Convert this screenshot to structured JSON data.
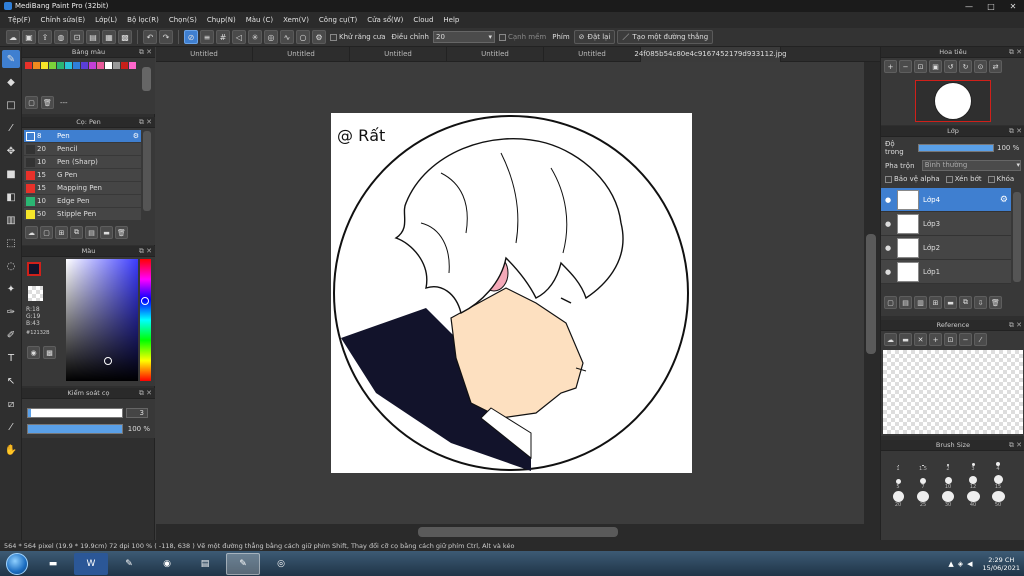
{
  "window": {
    "title": "MediBang Paint Pro (32bit)",
    "controls": [
      "—",
      "□",
      "✕"
    ]
  },
  "menu": [
    "Tệp(F)",
    "Chỉnh sửa(E)",
    "Lớp(L)",
    "Bộ lọc(R)",
    "Chọn(S)",
    "Chụp(N)",
    "Màu (C)",
    "Xem(V)",
    "Công cụ(T)",
    "Cửa sổ(W)",
    "Cloud",
    "Help"
  ],
  "toolbar": {
    "antialias_label": "Khử răng cưa",
    "correction_label": "Điều chỉnh",
    "correction_value": "20",
    "margin_label": "Cạnh mềm",
    "key_label": "Phím",
    "reset_label": "Đặt lại",
    "straight_line_label": "Tạo một đường thẳng"
  },
  "doc_tabs": [
    "Untitled",
    "Untitled",
    "Untitled",
    "Untitled",
    "Untitled",
    "24f085b54c80e4c9167452179d933112.jpg"
  ],
  "left": {
    "palette_title": "Bảng màu",
    "palette_colors": [
      "#e8312a",
      "#f08a1f",
      "#f5e52a",
      "#7cd33a",
      "#2bb673",
      "#2bc4d9",
      "#2f7fd9",
      "#5a3fd6",
      "#c23fd6",
      "#e85a9a",
      "#ffffff",
      "#999999",
      "#c8201a",
      "#ff66cc"
    ],
    "palette_dash": "---",
    "brush_title": "Cọ: Pen",
    "brushes": [
      {
        "size": "8",
        "name": "Pen",
        "color": "#3f7fd0",
        "selected": true
      },
      {
        "size": "20",
        "name": "Pencil",
        "color": "#333333"
      },
      {
        "size": "10",
        "name": "Pen (Sharp)",
        "color": "#333333"
      },
      {
        "size": "15",
        "name": "G Pen",
        "color": "#e8312a"
      },
      {
        "size": "15",
        "name": "Mapping Pen",
        "color": "#e8312a"
      },
      {
        "size": "10",
        "name": "Edge Pen",
        "color": "#2bb673"
      },
      {
        "size": "50",
        "name": "Stipple Pen",
        "color": "#f5e52a"
      }
    ],
    "color_title": "Màu",
    "rgb": {
      "r": "R:18",
      "g": "G:19",
      "b": "B:43",
      "hex": "#12132B"
    },
    "brush_ctrl_title": "Kiểm soát cọ",
    "brush_size": "3",
    "brush_opacity": "100 %"
  },
  "right": {
    "navigator_title": "Hoa tiêu",
    "layer_title": "Lớp",
    "opacity_label": "Độ trong",
    "opacity_value": "100 %",
    "blend_label": "Pha trộn",
    "blend_value": "Bình thường",
    "protect_alpha": "Bảo vệ alpha",
    "clipping": "Xén bớt",
    "lock": "Khóa",
    "layers": [
      {
        "name": "Lớp4",
        "selected": true
      },
      {
        "name": "Lớp3"
      },
      {
        "name": "Lớp2"
      },
      {
        "name": "Lớp1"
      }
    ],
    "reference_title": "Reference",
    "brushsize_title": "Brush Size",
    "brush_sizes": [
      "1",
      "1.5",
      "2",
      "3",
      "4",
      "5",
      "7",
      "10",
      "12",
      "15",
      "20",
      "25",
      "30",
      "40",
      "50"
    ]
  },
  "status": "564 * 564 pixel  (19.9 * 19.9cm)  72 dpi  100 %  ( -118, 638 )  Vẽ một đường thẳng bằng cách giữ phím Shift, Thay đổi cỡ cọ bằng cách giữ phím Ctrl, Alt và kéo",
  "taskbar": {
    "time": "2:29 CH",
    "date": "15/06/2021"
  },
  "canvas": {
    "signature": "@ Rất"
  }
}
